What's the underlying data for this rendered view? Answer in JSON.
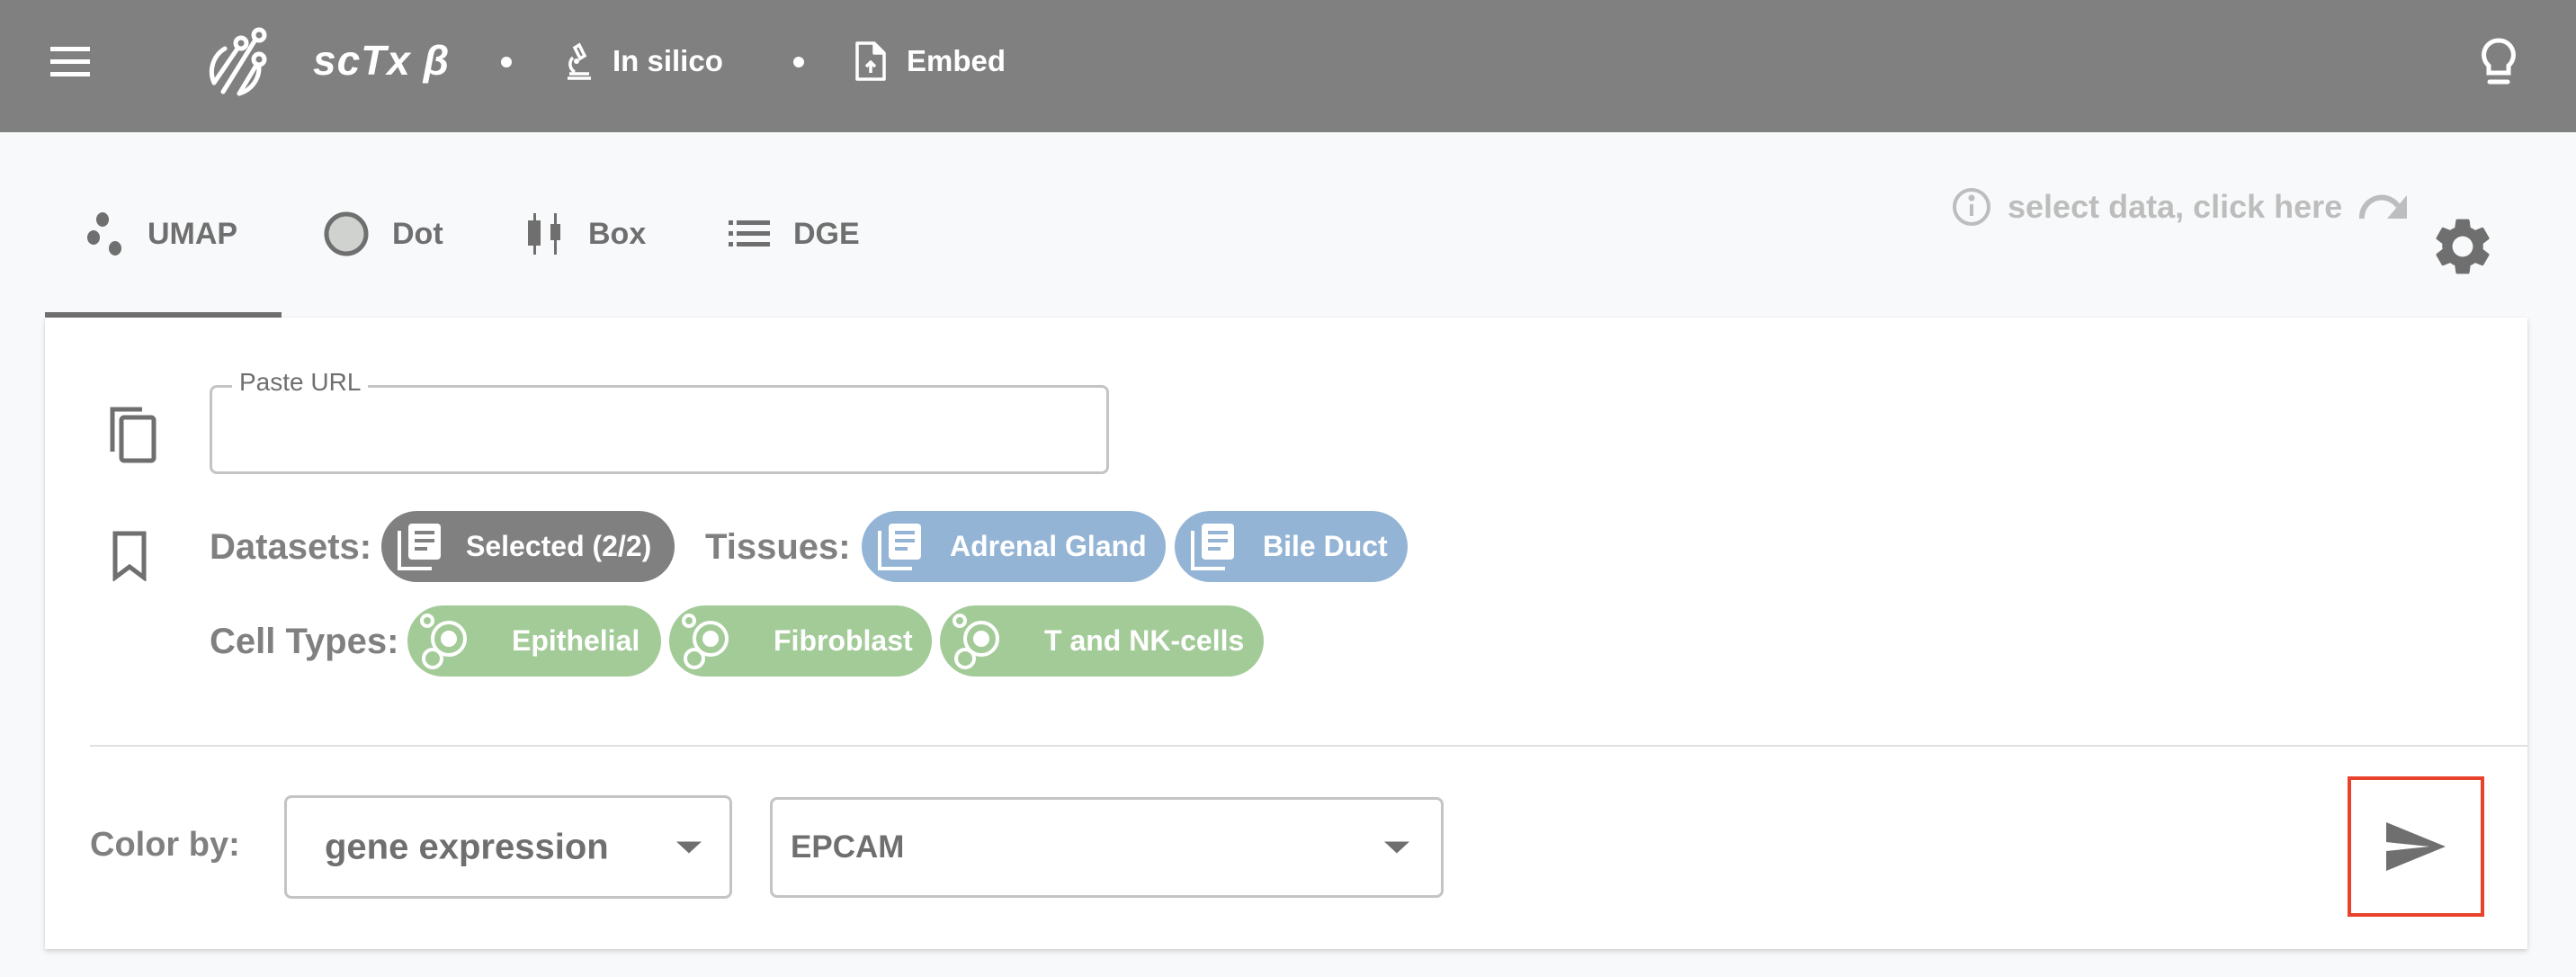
{
  "header": {
    "brand": "scTx β",
    "nav": [
      {
        "label": "In silico",
        "icon": "microscope-icon"
      },
      {
        "label": "Embed",
        "icon": "file-upload-icon"
      }
    ],
    "menu_icon": "hamburger-menu-icon",
    "help_icon": "lightbulb-icon"
  },
  "tabs": [
    {
      "label": "UMAP",
      "icon": "scatter-dots-icon",
      "active": true
    },
    {
      "label": "Dot",
      "icon": "circle-icon",
      "active": false
    },
    {
      "label": "Box",
      "icon": "boxplot-icon",
      "active": false
    },
    {
      "label": "DGE",
      "icon": "list-icon",
      "active": false
    }
  ],
  "hint": {
    "text": "select data, click here",
    "icon": "info-icon"
  },
  "settings_icon": "gear-icon",
  "url_field": {
    "label": "Paste URL",
    "value": "",
    "placeholder": ""
  },
  "datasets": {
    "label": "Datasets:",
    "chips": [
      "Selected (2/2)"
    ]
  },
  "tissues": {
    "label": "Tissues:",
    "chips": [
      "Adrenal Gland",
      "Bile Duct"
    ]
  },
  "cell_types": {
    "label": "Cell Types:",
    "chips": [
      "Epithelial",
      "Fibroblast",
      "T and NK-cells"
    ]
  },
  "color_by": {
    "label": "Color by:",
    "mode": "gene expression",
    "gene": "EPCAM"
  },
  "colors": {
    "header_bg": "#808080",
    "dataset_chip": "#808080",
    "tissue_chip": "#94b4d6",
    "celltype_chip": "#a3cb98",
    "highlight_border": "#e8412c"
  }
}
